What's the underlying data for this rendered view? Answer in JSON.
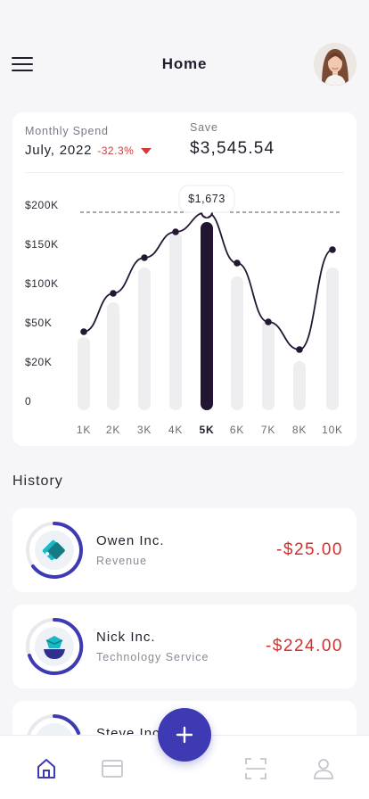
{
  "header": {
    "title": "Home",
    "menu_icon": "hamburger-menu-icon",
    "avatar_icon": "user-avatar"
  },
  "summary": {
    "spend_label": "Monthly Spend",
    "month": "July, 2022",
    "change": "-32.3%",
    "change_icon": "caret-down-icon",
    "save_label": "Save",
    "save_value": "$3,545.54"
  },
  "chart_data": {
    "type": "line",
    "y_ticks": [
      "$200K",
      "$150K",
      "$100K",
      "$50K",
      "$20K",
      "0"
    ],
    "categories": [
      "1K",
      "2K",
      "3K",
      "4K",
      "5K",
      "6K",
      "7K",
      "8K",
      "10K"
    ],
    "selected_index": 4,
    "selected_label": "$1,673",
    "bar_values": [
      82,
      121,
      160,
      200,
      211,
      150,
      102,
      55,
      160
    ],
    "series": [
      {
        "values": [
          88,
          131,
          171,
          200,
          222,
          165,
          99,
          68,
          180
        ]
      }
    ],
    "ylim": [
      0,
      260
    ],
    "colors": {
      "line": "#241734",
      "bar": "#eeeef0",
      "bar_selected": "#221532"
    }
  },
  "history": {
    "title": "History",
    "items": [
      {
        "name": "Owen Inc.",
        "category": "Revenue",
        "amount": "-$25.00",
        "icon": "tag-icon"
      },
      {
        "name": "Nick Inc.",
        "category": "Technology Service",
        "amount": "-$224.00",
        "icon": "gem-bowl-icon"
      },
      {
        "name": "Steve Inc.",
        "category": "",
        "amount": "",
        "icon": "drop-icon"
      }
    ]
  },
  "tabbar": {
    "tabs": [
      "home-icon",
      "wallet-card-icon",
      "scan-icon",
      "profile-icon"
    ],
    "fab_icon": "plus-icon",
    "active_color": "#3d3ab4",
    "inactive_color": "#c4c4cc"
  }
}
